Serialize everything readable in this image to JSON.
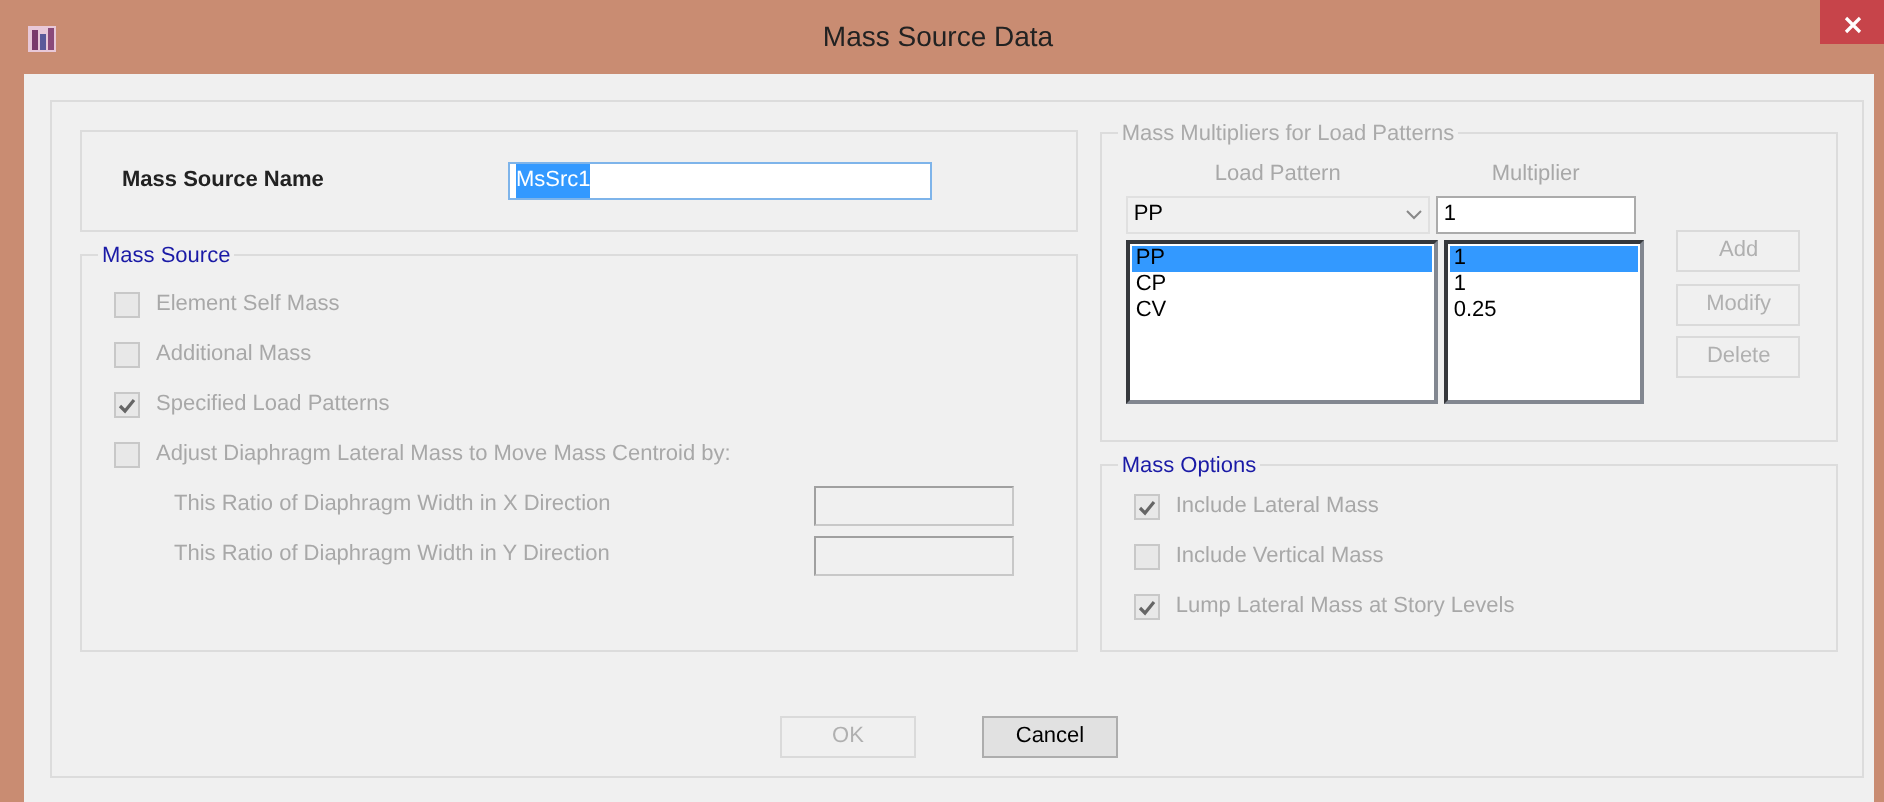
{
  "window": {
    "title": "Mass Source Data"
  },
  "name_field": {
    "label": "Mass Source Name",
    "value": "MsSrc1",
    "text_selected": true
  },
  "mass_source": {
    "title": "Mass Source",
    "options": [
      {
        "label": "Element Self Mass",
        "checked": false,
        "disabled": true
      },
      {
        "label": "Additional Mass",
        "checked": false,
        "disabled": true
      },
      {
        "label": "Specified Load Patterns",
        "checked": true,
        "disabled": true
      },
      {
        "label": "Adjust Diaphragm Lateral Mass to Move Mass Centroid by:",
        "checked": false,
        "disabled": true
      }
    ],
    "ratios": [
      {
        "label": "This Ratio of Diaphragm Width in X Direction",
        "disabled": true
      },
      {
        "label": "This Ratio of Diaphragm Width in Y Direction",
        "disabled": true
      }
    ]
  },
  "multipliers": {
    "title": "Mass Multipliers for Load Patterns",
    "headers": [
      "Load Pattern",
      "Multiplier"
    ],
    "headers_disabled": true,
    "load_pattern_select": "PP",
    "multiplier_input": "1",
    "rows": [
      {
        "load_pattern": "PP",
        "multiplier": "1",
        "selected": true
      },
      {
        "load_pattern": "CP",
        "multiplier": "1",
        "selected": false
      },
      {
        "load_pattern": "CV",
        "multiplier": "0.25",
        "selected": false
      }
    ],
    "buttons": [
      {
        "label": "Add",
        "disabled": true
      },
      {
        "label": "Modify",
        "disabled": true
      },
      {
        "label": "Delete",
        "disabled": true
      }
    ]
  },
  "mass_options": {
    "title": "Mass Options",
    "options": [
      {
        "label": "Include Lateral Mass",
        "checked": true,
        "disabled": true
      },
      {
        "label": "Include Vertical Mass",
        "checked": false,
        "disabled": true
      },
      {
        "label": "Lump Lateral Mass at Story Levels",
        "checked": true,
        "disabled": true
      }
    ]
  },
  "buttons": [
    {
      "label": "OK",
      "disabled": true
    },
    {
      "label": "Cancel",
      "disabled": false
    }
  ]
}
